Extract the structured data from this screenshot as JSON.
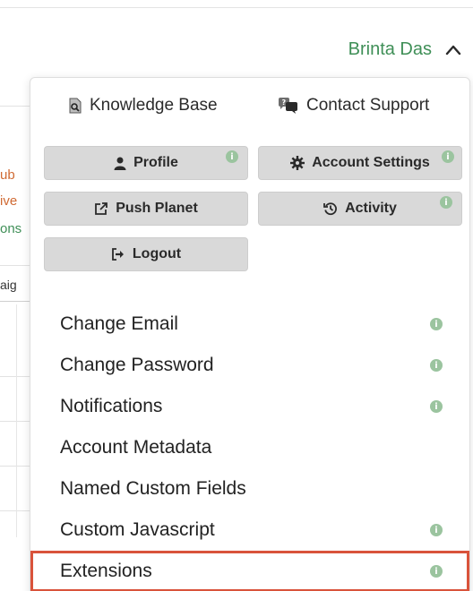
{
  "header": {
    "user_name": "Brinta Das"
  },
  "background_fragments": [
    "ub",
    "ive",
    "ons",
    "aig"
  ],
  "menu": {
    "knowledge_base": "Knowledge Base",
    "contact_support": "Contact Support",
    "buttons": [
      {
        "label": "Profile",
        "icon": "user-icon"
      },
      {
        "label": "Account Settings",
        "icon": "gear-icon"
      },
      {
        "label": "Push Planet",
        "icon": "external-link-icon"
      },
      {
        "label": "Activity",
        "icon": "history-icon"
      },
      {
        "label": "Logout",
        "icon": "logout-icon"
      }
    ],
    "items": [
      {
        "label": "Change Email"
      },
      {
        "label": "Change Password"
      },
      {
        "label": "Notifications"
      },
      {
        "label": "Account Metadata"
      },
      {
        "label": "Named Custom Fields"
      },
      {
        "label": "Custom Javascript"
      },
      {
        "label": "Extensions"
      }
    ],
    "info_glyph": "i",
    "selected_item": "Extensions"
  },
  "colors": {
    "brand_green": "#3f8f57",
    "button_gray": "#d9d9d9",
    "info_green": "#9bc49f",
    "highlight_red": "#d9533b",
    "fragment_orange": "#d06a33"
  }
}
